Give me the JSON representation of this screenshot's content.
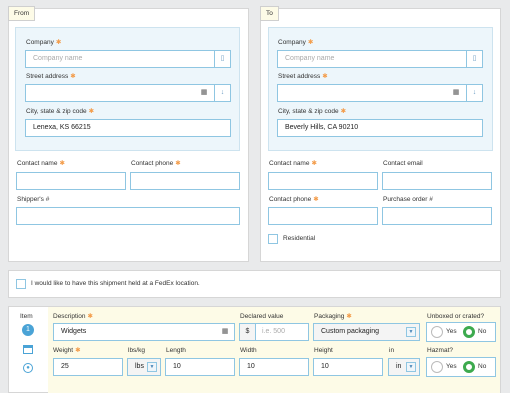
{
  "from": {
    "tab": "From",
    "company_label": "Company",
    "company_placeholder": "Company name",
    "street_label": "Street address",
    "street_value": "",
    "city_label": "City, state & zip code",
    "city_value": "Lenexa, KS 66215",
    "contact_name_label": "Contact name",
    "contact_phone_label": "Contact phone",
    "shippers_label": "Shipper's #"
  },
  "to": {
    "tab": "To",
    "company_label": "Company",
    "company_placeholder": "Company name",
    "street_label": "Street address",
    "street_value": "",
    "city_label": "City, state & zip code",
    "city_value": "Beverly Hills, CA 90210",
    "contact_name_label": "Contact name",
    "contact_email_label": "Contact email",
    "contact_phone_label": "Contact phone",
    "purchase_order_label": "Purchase order #",
    "residential_label": "Residential"
  },
  "hold": {
    "label": "I would like to have this shipment held at a FedEx location."
  },
  "item": {
    "item_label": "Item",
    "item_number": "1",
    "description_label": "Description",
    "description_value": "Widgets",
    "declared_label": "Declared value",
    "currency": "$",
    "declared_placeholder": "i.e. 500",
    "packaging_label": "Packaging",
    "packaging_value": "Custom packaging",
    "unboxed_label": "Unboxed or crated?",
    "yes": "Yes",
    "no": "No",
    "weight_label": "Weight",
    "weight_value": "25",
    "units_label": "lbs/kg",
    "units_value": "lbs",
    "length_label": "Length",
    "length_value": "10",
    "width_label": "Width",
    "width_value": "10",
    "height_label": "Height",
    "height_value": "10",
    "dim_units_label": "in",
    "dim_units_value": "in",
    "hazmat_label": "Hazmat?"
  },
  "colors": {
    "required": "#f39c4a",
    "field_border": "#8fc6e2",
    "radio_selected": "#3daa4e",
    "item_badge": "#4aa3d6"
  }
}
